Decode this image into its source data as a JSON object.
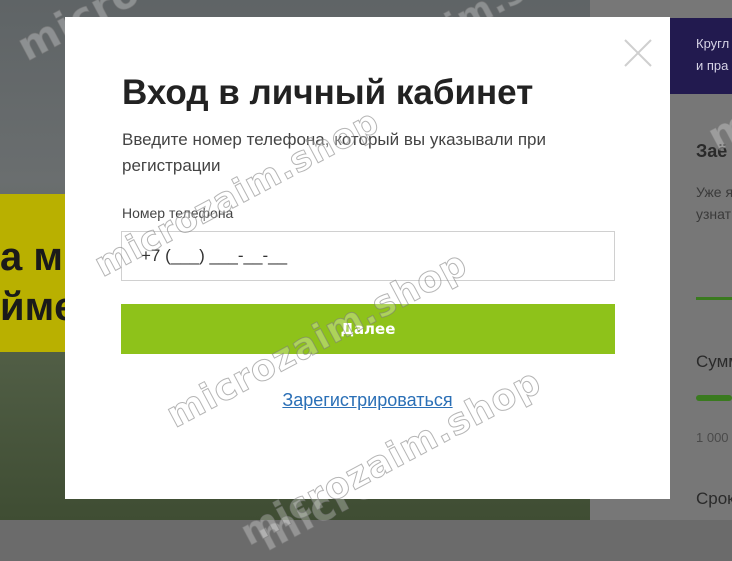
{
  "modal": {
    "title": "Вход в личный кабинет",
    "subtitle": "Введите номер телефона, который вы указывали при регистрации",
    "phone_label": "Номер телефона",
    "phone_value": "+7 (___) ___-__-__",
    "next_label": "Далее",
    "register_label": "Зарегистрироваться",
    "accent_color": "#8ec21a",
    "link_color": "#2a6fb6"
  },
  "background": {
    "banner_text_1": "а м",
    "banner_text_2": "йме",
    "header_line_1": "Кругл",
    "header_line_2": "и пра",
    "right_title": "Заё",
    "right_text_1": "Уже я",
    "right_text_2": "узнат",
    "sum_label": "Сумм",
    "sum_min": "1 000",
    "term_label": "Срок"
  },
  "watermark": {
    "text": "microzaim.shop"
  }
}
